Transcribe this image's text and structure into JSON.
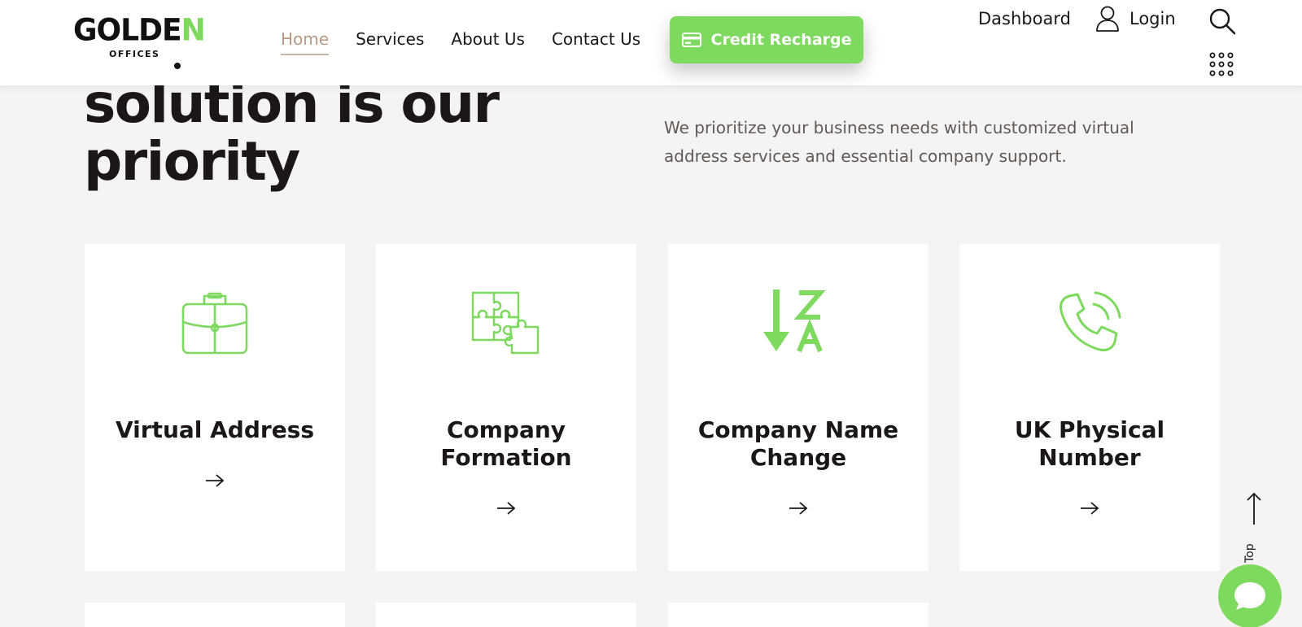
{
  "brand": {
    "logo_main": "GOLDE",
    "logo_accent": "N",
    "logo_sub": "OFFICES",
    "accent_color": "#7ed95f"
  },
  "nav": {
    "items": [
      {
        "label": "Home",
        "active": true
      },
      {
        "label": "Services",
        "active": false
      },
      {
        "label": "About Us",
        "active": false
      },
      {
        "label": "Contact Us",
        "active": false
      }
    ],
    "recharge_label": "Credit Recharge",
    "dashboard_label": "Dashboard",
    "login_label": "Login"
  },
  "hero": {
    "title_line1": "solution is our",
    "title_line2": "priority",
    "description": "We prioritize your business needs with customized virtual address services and essential company support."
  },
  "services": [
    {
      "title": "Virtual Address",
      "icon": "briefcase-icon"
    },
    {
      "title": "Company Formation",
      "icon": "puzzle-icon"
    },
    {
      "title": "Company Name Change",
      "icon": "sort-z-a-icon"
    },
    {
      "title": "UK Physical Number",
      "icon": "phone-icon"
    }
  ],
  "floating": {
    "top_label": "Top"
  }
}
